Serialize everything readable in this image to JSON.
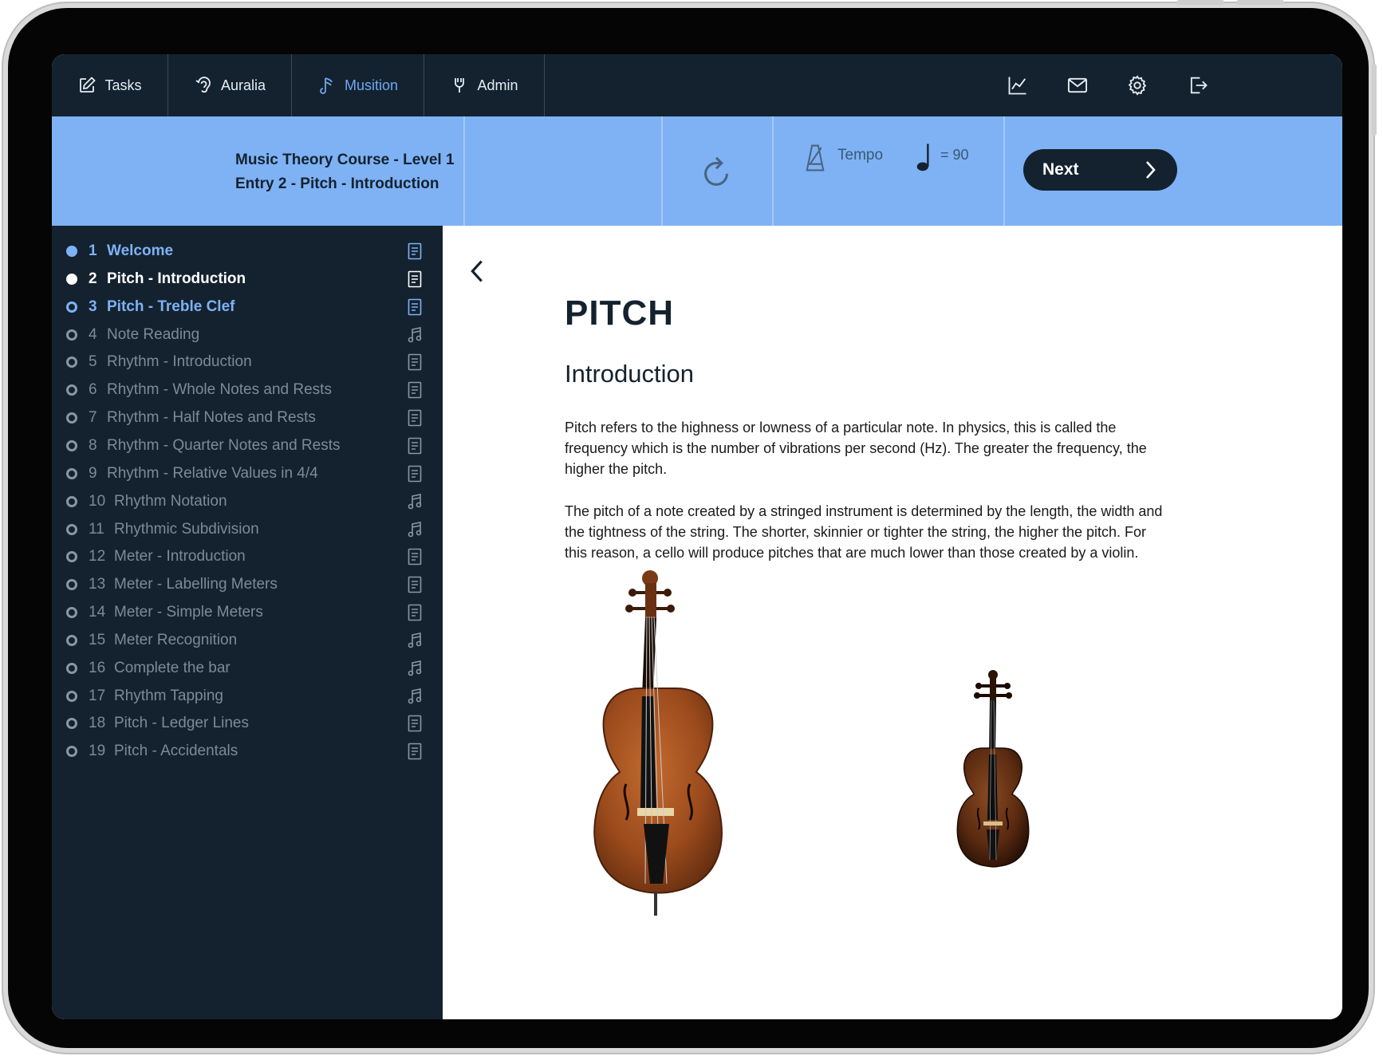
{
  "nav": {
    "tabs": [
      {
        "label": "Tasks",
        "icon": "edit-icon"
      },
      {
        "label": "Auralia",
        "icon": "auralia-icon"
      },
      {
        "label": "Musition",
        "icon": "musition-icon",
        "active": true
      },
      {
        "label": "Admin",
        "icon": "admin-icon"
      }
    ],
    "right_icons": [
      "chart-icon",
      "mail-icon",
      "gear-icon",
      "logout-icon"
    ]
  },
  "toolbar": {
    "course_line1": "Music Theory Course - Level 1",
    "course_line2": "Entry 2 - Pitch - Introduction",
    "tempo_label": "Tempo",
    "tempo_value": "= 90",
    "tempo_slider_fraction": 0.34,
    "next_label": "Next"
  },
  "lessons": [
    {
      "num": "1",
      "label": "Welcome",
      "state": "done",
      "type": "document"
    },
    {
      "num": "2",
      "label": "Pitch - Introduction",
      "state": "current",
      "type": "document"
    },
    {
      "num": "3",
      "label": "Pitch - Treble Clef",
      "state": "next",
      "type": "document"
    },
    {
      "num": "4",
      "label": "Note Reading",
      "state": "locked",
      "type": "music"
    },
    {
      "num": "5",
      "label": "Rhythm - Introduction",
      "state": "locked",
      "type": "document"
    },
    {
      "num": "6",
      "label": "Rhythm - Whole Notes and Rests",
      "state": "locked",
      "type": "document"
    },
    {
      "num": "7",
      "label": "Rhythm - Half Notes and Rests",
      "state": "locked",
      "type": "document"
    },
    {
      "num": "8",
      "label": "Rhythm - Quarter Notes and Rests",
      "state": "locked",
      "type": "document"
    },
    {
      "num": "9",
      "label": "Rhythm - Relative Values in 4/4",
      "state": "locked",
      "type": "document"
    },
    {
      "num": "10",
      "label": "Rhythm Notation",
      "state": "locked",
      "type": "music"
    },
    {
      "num": "11",
      "label": "Rhythmic Subdivision",
      "state": "locked",
      "type": "music"
    },
    {
      "num": "12",
      "label": "Meter - Introduction",
      "state": "locked",
      "type": "document"
    },
    {
      "num": "13",
      "label": "Meter - Labelling Meters",
      "state": "locked",
      "type": "document"
    },
    {
      "num": "14",
      "label": "Meter - Simple Meters",
      "state": "locked",
      "type": "document"
    },
    {
      "num": "15",
      "label": "Meter Recognition",
      "state": "locked",
      "type": "music"
    },
    {
      "num": "16",
      "label": "Complete the bar",
      "state": "locked",
      "type": "music"
    },
    {
      "num": "17",
      "label": "Rhythm Tapping",
      "state": "locked",
      "type": "music"
    },
    {
      "num": "18",
      "label": "Pitch - Ledger Lines",
      "state": "locked",
      "type": "document"
    },
    {
      "num": "19",
      "label": "Pitch - Accidentals",
      "state": "locked",
      "type": "document"
    }
  ],
  "content": {
    "title": "PITCH",
    "subtitle": "Introduction",
    "paragraph1": "Pitch refers to the highness or lowness of a particular note. In physics, this is called the frequency which is the number of vibrations per second (Hz). The greater the frequency, the higher the pitch.",
    "paragraph2": "The pitch of a note created by a stringed instrument is determined by the length, the width and the tightness of the string. The shorter, skinnier or tighter the string, the higher the pitch. For this reason, a cello will produce pitches that are much lower than those created by a violin.",
    "images": [
      "cello-image",
      "violin-image"
    ]
  },
  "colors": {
    "nav_bg": "#14222f",
    "toolbar_bg": "#7eb2f4",
    "accent": "#7eb2f4",
    "active_tab": "#6ea8f0"
  }
}
